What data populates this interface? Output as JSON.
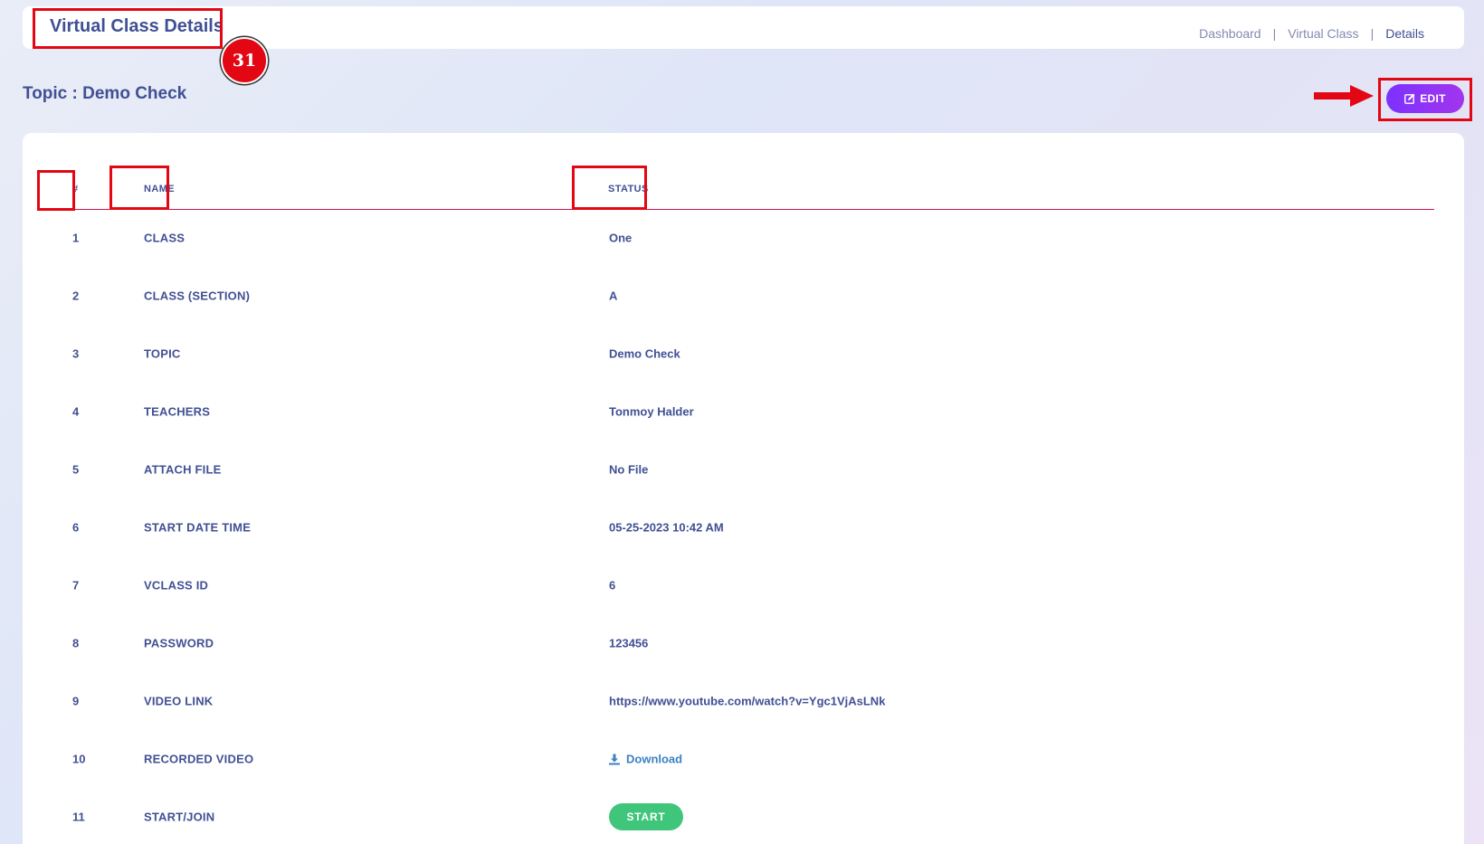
{
  "header": {
    "title": "Virtual Class Details",
    "step_badge": "31",
    "breadcrumb": [
      {
        "label": "Dashboard"
      },
      {
        "label": "Virtual Class"
      },
      {
        "label": "Details"
      }
    ]
  },
  "topic": {
    "title": "Topic : Demo Check"
  },
  "edit_button": {
    "label": "EDIT"
  },
  "table": {
    "headers": {
      "num": "#",
      "name": "NAME",
      "status": "STATUS"
    },
    "rows": [
      {
        "num": "1",
        "name": "CLASS",
        "status": "One"
      },
      {
        "num": "2",
        "name": "CLASS (SECTION)",
        "status": "A"
      },
      {
        "num": "3",
        "name": "TOPIC",
        "status": "Demo Check"
      },
      {
        "num": "4",
        "name": "TEACHERS",
        "status": "Tonmoy Halder"
      },
      {
        "num": "5",
        "name": "ATTACH FILE",
        "status": "No File"
      },
      {
        "num": "6",
        "name": "START DATE TIME",
        "status": "05-25-2023 10:42 AM"
      },
      {
        "num": "7",
        "name": "VCLASS ID",
        "status": "6"
      },
      {
        "num": "8",
        "name": "PASSWORD",
        "status": "123456"
      },
      {
        "num": "9",
        "name": "VIDEO LINK",
        "status": "https://www.youtube.com/watch?v=Ygc1VjAsLNk"
      },
      {
        "num": "10",
        "name": "RECORDED VIDEO",
        "status": "Download"
      },
      {
        "num": "11",
        "name": "START/JOIN",
        "status": "START"
      }
    ]
  },
  "colors": {
    "primary_text": "#415094",
    "accent_purple": "#7c32ff",
    "annotation_red": "#e30613",
    "start_green": "#3fc67a",
    "link_blue": "#3b82c4",
    "header_divider": "#d3134f"
  }
}
